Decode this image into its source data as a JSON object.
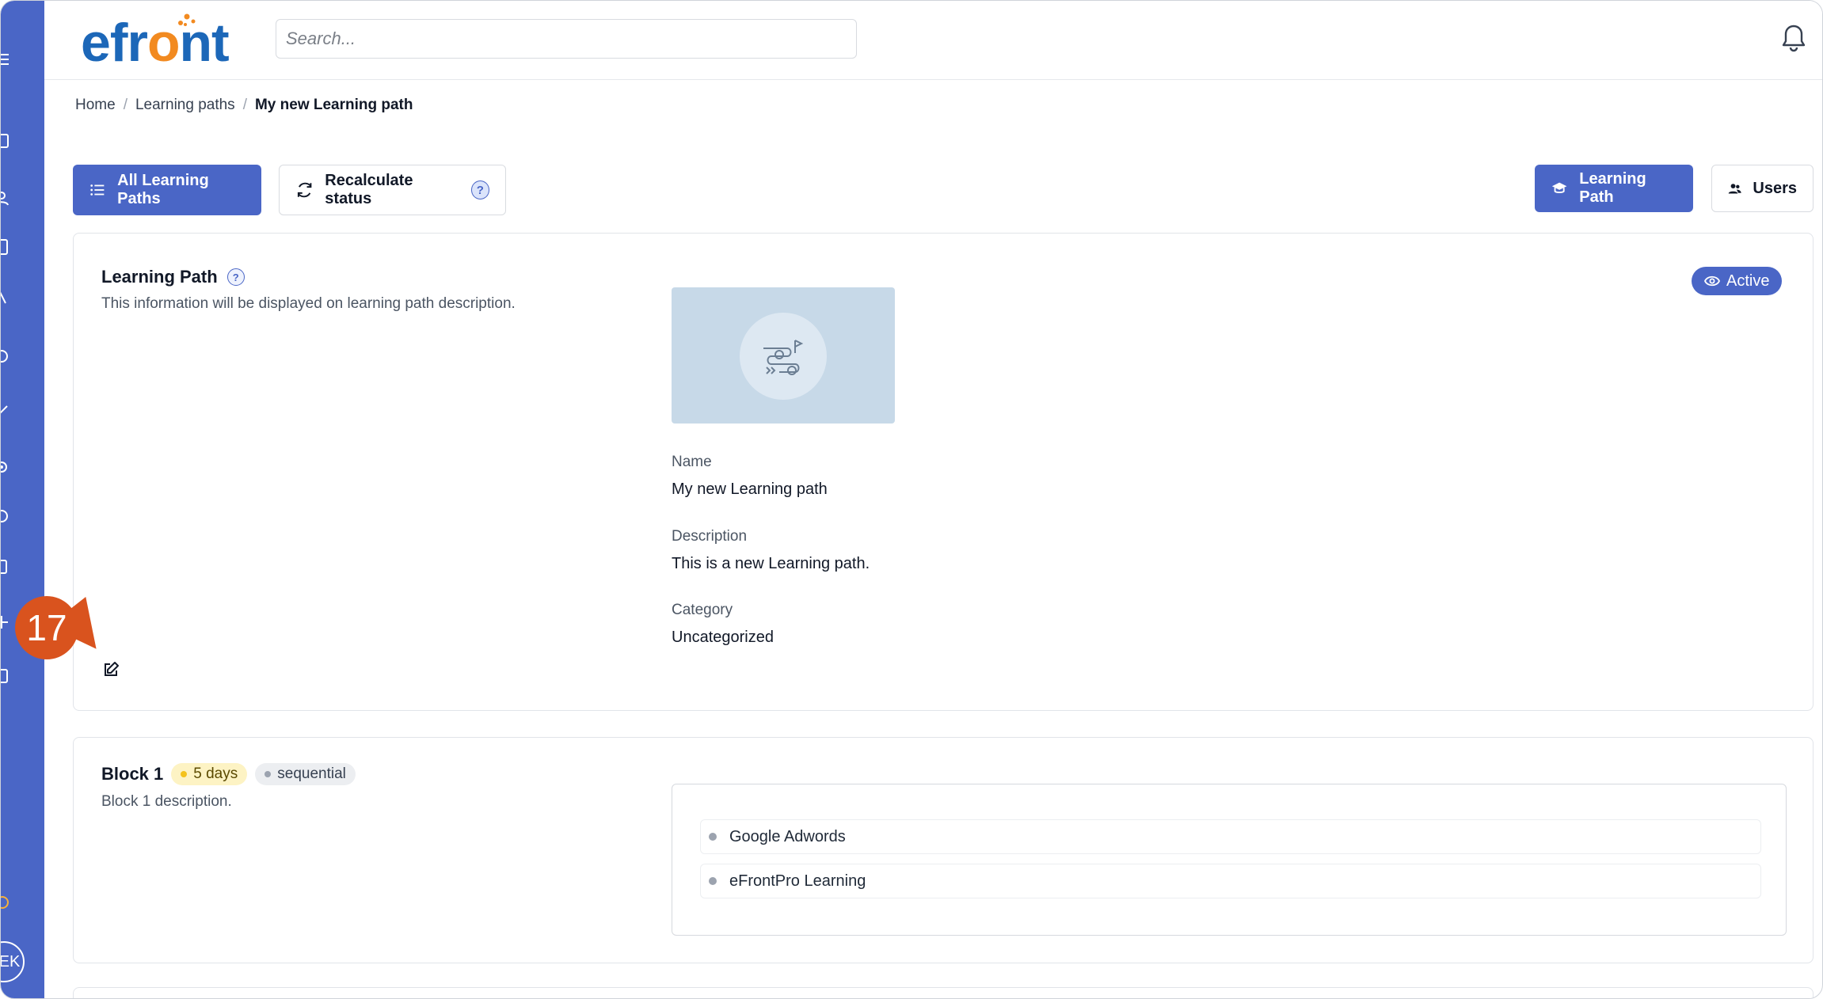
{
  "header": {
    "logo_text": "efront",
    "search_placeholder": "Search..."
  },
  "breadcrumb": {
    "items": [
      "Home",
      "Learning paths",
      "My new Learning path"
    ]
  },
  "actions": {
    "all_learning_paths": "All Learning Paths",
    "recalculate_status": "Recalculate status",
    "learning_path_tab": "Learning Path",
    "users_tab": "Users"
  },
  "learning_path_card": {
    "title": "Learning Path",
    "subtitle": "This information will be displayed on learning path description.",
    "status": "Active",
    "name_label": "Name",
    "name_value": "My new Learning path",
    "description_label": "Description",
    "description_value": "This is a new Learning path.",
    "category_label": "Category",
    "category_value": "Uncategorized"
  },
  "step_marker": "17",
  "block": {
    "title": "Block 1",
    "duration": "5 days",
    "mode": "sequential",
    "description": "Block 1 description.",
    "courses": [
      "Google Adwords",
      "eFrontPro Learning"
    ]
  },
  "sidebar": {
    "avatar_initials": "EK"
  },
  "colors": {
    "brand_blue": "#4a66c6",
    "logo_blue": "#1c67b8",
    "logo_orange": "#f28a20",
    "marker_orange": "#d9531e"
  }
}
